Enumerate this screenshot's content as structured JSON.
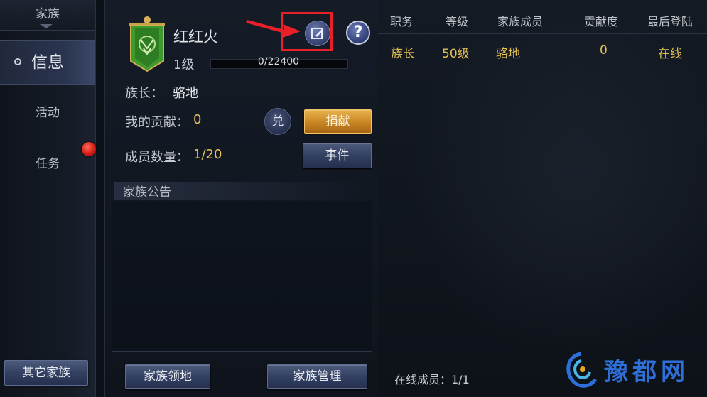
{
  "sidebar": {
    "title": "家族",
    "items": [
      {
        "label": "信息",
        "active": true
      },
      {
        "label": "活动",
        "active": false
      },
      {
        "label": "任务",
        "active": false,
        "has_badge": true
      }
    ],
    "other_clans_button": "其它家族"
  },
  "clan": {
    "name": "红红火",
    "level": "1级",
    "exp_text": "0/22400",
    "exp_fraction": 0,
    "leader_label": "族长：",
    "leader_name": "骆地",
    "contribution_label": "我的贡献：",
    "contribution_value": "0",
    "exchange_label": "兑",
    "donate_button": "捐献",
    "members_label": "成员数量：",
    "members_value": "1/20",
    "events_button": "事件",
    "notice_title": "家族公告",
    "territory_button": "家族领地",
    "manage_button": "家族管理",
    "help_icon": "?"
  },
  "members": {
    "headers": [
      "职务",
      "等级",
      "家族成员",
      "贡献度",
      "最后登陆"
    ],
    "rows": [
      {
        "role": "族长",
        "level": "50级",
        "name": "骆地",
        "contribution": "0",
        "last_login": "在线"
      }
    ],
    "online_label": "在线成员：1/1"
  },
  "watermark": {
    "text": "豫都网"
  },
  "colors": {
    "accent_gold": "#e3bf55",
    "annotation_red": "#e8202a",
    "banner_green": "#3f9a2e",
    "watermark_blue": "#2e6fd8"
  },
  "icons": [
    "edit-icon",
    "help-icon",
    "exchange-icon",
    "banner-icon",
    "radio-dot-icon",
    "notification-dot-icon",
    "annotation-arrow-icon",
    "watermark-logo-icon"
  ]
}
